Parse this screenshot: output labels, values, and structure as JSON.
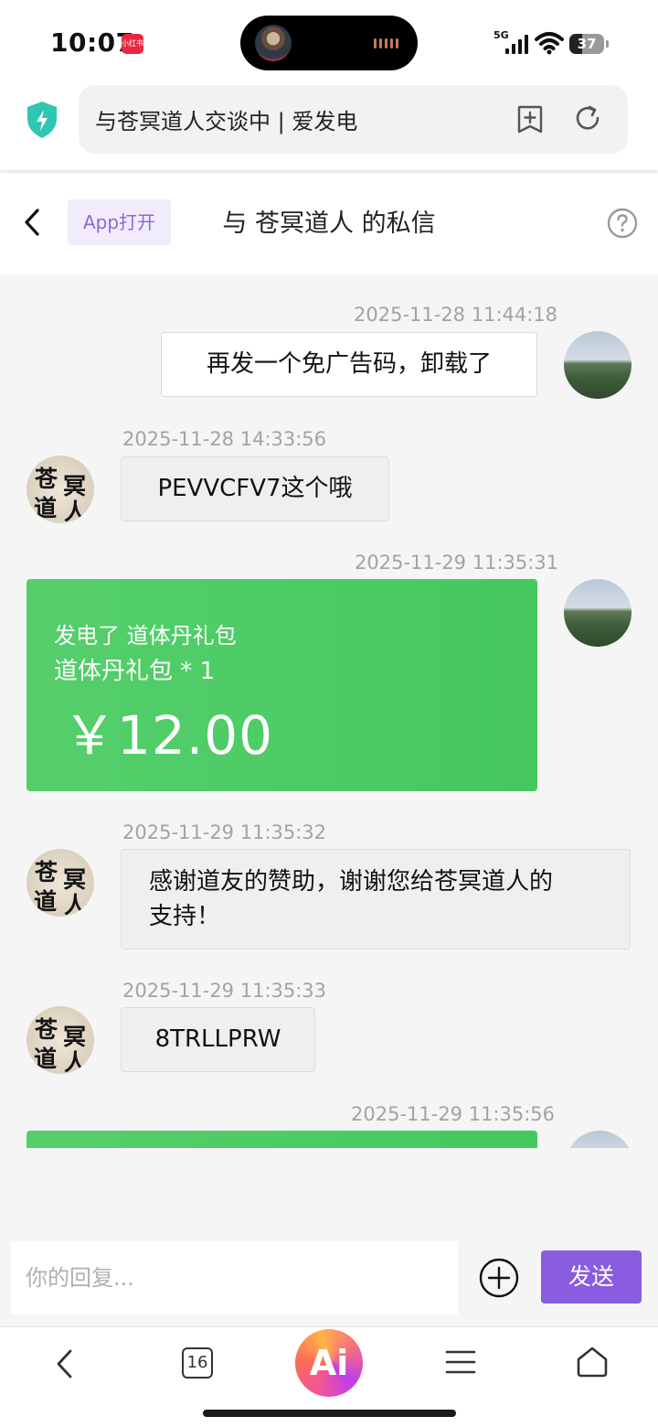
{
  "status": {
    "time": "10:07",
    "app_badge": "小红书",
    "signal": "5G",
    "battery": "37"
  },
  "browser": {
    "tab_title": "与苍冥道人交谈中 | 爱发电",
    "tab_count": "16",
    "ai_label": "Ai"
  },
  "header": {
    "app_open": "App打开",
    "title": "与 苍冥道人 的私信"
  },
  "callig": [
    "苍",
    "冥",
    "道",
    "人"
  ],
  "messages": [
    {
      "time": "2025-11-28 11:44:18",
      "text": "再发一个免广告码，卸载了"
    },
    {
      "time": "2025-11-28 14:33:56",
      "text": "PEVVCFV7这个哦"
    },
    {
      "time": "2025-11-29 11:35:31",
      "gift_title": "发电了 道体丹礼包",
      "gift_item": "道体丹礼包 * 1",
      "gift_amount": "￥12.00"
    },
    {
      "time": "2025-11-29 11:35:32",
      "text_line1": "感谢道友的赞助，谢谢您给苍冥道人的",
      "text_line2": "支持！"
    },
    {
      "time": "2025-11-29 11:35:33",
      "text": "8TRLLPRW"
    },
    {
      "time": "2025-11-29 11:35:56"
    }
  ],
  "reply": {
    "placeholder": "你的回复...",
    "send": "发送"
  },
  "colors": {
    "accent": "#8a5cdf",
    "gift": "#4ccb63",
    "shield": "#2fc7b4"
  }
}
